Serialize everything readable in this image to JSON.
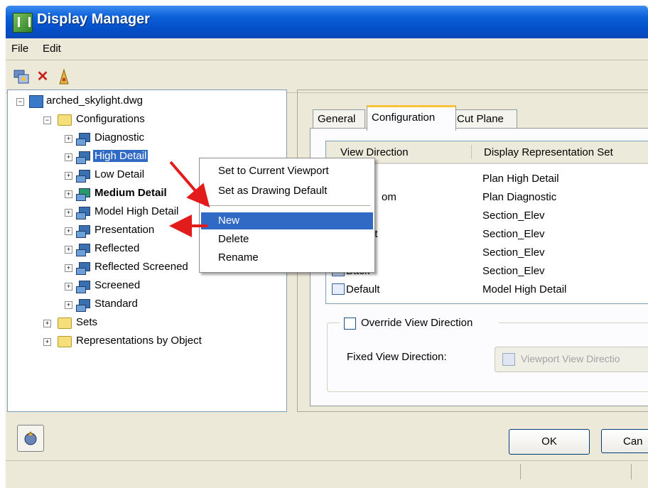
{
  "window": {
    "title": "Display Manager"
  },
  "menu": {
    "file": "File",
    "edit": "Edit"
  },
  "toolbar": {
    "icons": [
      "display-config-icon",
      "delete-icon",
      "purge-icon"
    ]
  },
  "tree": {
    "root": "arched_skylight.dwg",
    "configurations": "Configurations",
    "items": [
      "Diagnostic",
      "High Detail",
      "Low Detail",
      "Medium Detail",
      "Model High Detail",
      "Presentation",
      "Reflected",
      "Reflected Screened",
      "Screened",
      "Standard"
    ],
    "sets": "Sets",
    "reps_by_object": "Representations by Object",
    "selected": "High Detail",
    "bold": "Medium Detail"
  },
  "tabs": {
    "general": "General",
    "configuration": "Configuration",
    "cut_plane": "Cut Plane"
  },
  "list": {
    "col1": "View Direction",
    "col2": "Display Representation Set",
    "rows": [
      {
        "view": "",
        "set": "Plan High Detail"
      },
      {
        "view": "om",
        "set": "Plan Diagnostic"
      },
      {
        "view": "",
        "set": "Section_Elev"
      },
      {
        "view": "nt",
        "set": "Section_Elev"
      },
      {
        "view": "t",
        "set": "Section_Elev"
      },
      {
        "view": "Back",
        "set": "Section_Elev"
      },
      {
        "view": "Default",
        "set": "Model High Detail"
      }
    ]
  },
  "override": {
    "label": "Override View Direction",
    "checked": false
  },
  "fixed": {
    "label": "Fixed View Direction:",
    "value": "Viewport View Directio"
  },
  "buttons": {
    "ok": "OK",
    "cancel": "Can"
  },
  "context_menu": {
    "items": [
      "Set to Current Viewport",
      "Set as Drawing Default",
      "New",
      "Delete",
      "Rename"
    ],
    "highlighted": "New"
  },
  "colors": {
    "title_bar": "#0450c9",
    "selection": "#316ac5",
    "arrow": "#e31b1b",
    "active_tab_accent": "#f9c33a"
  }
}
